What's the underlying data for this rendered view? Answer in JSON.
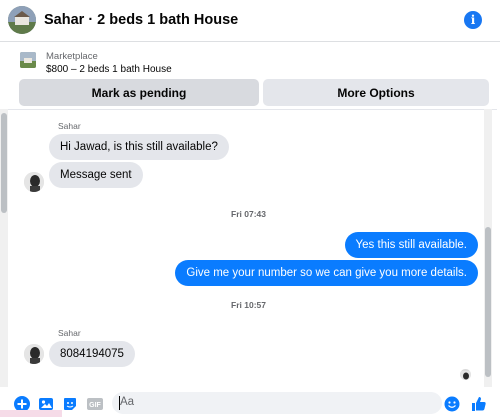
{
  "header": {
    "title": "Sahar · 2 beds 1 bath House"
  },
  "listing": {
    "category": "Marketplace",
    "name": "$800 – 2 beds 1 bath House"
  },
  "actions": {
    "pending_label": "Mark as pending",
    "more_label": "More Options"
  },
  "messages": [
    {
      "sender": "Sahar",
      "text": "Hi Jawad, is this still available?"
    },
    {
      "text": "Message sent"
    },
    {
      "timestamp": "Fri 07:43"
    },
    {
      "text": "Yes this still available."
    },
    {
      "text": "Give me your number so we can give you more details."
    },
    {
      "timestamp": "Fri 10:57"
    },
    {
      "sender": "Sahar",
      "text": "8084194075"
    }
  ],
  "composer": {
    "placeholder": "Aa",
    "gif_label": "GIF"
  },
  "colors": {
    "accent": "#0a7cff",
    "brand": "#1877f2",
    "bubble_in": "#e4e6eb"
  }
}
